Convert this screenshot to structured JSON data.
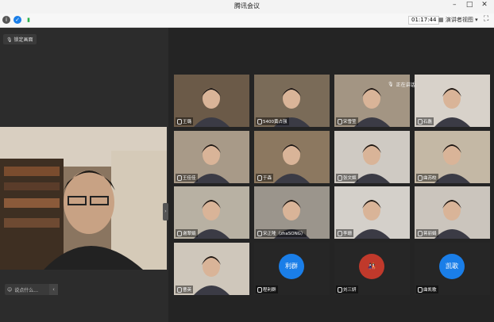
{
  "window": {
    "title": "腾讯会议",
    "minimize": "–",
    "maximize": "□",
    "close": "✕"
  },
  "toolbar": {
    "timer": "01:17:44",
    "speaker_view": "演讲者视图",
    "dropdown": "▾",
    "fullscreen": "⛶"
  },
  "left": {
    "mute_tag": "锁定画面",
    "chat_placeholder": "说点什么...",
    "chat_arrow": "‹",
    "collapse_arrow": "›"
  },
  "speaking_label": "正在讲话:",
  "participants": [
    {
      "name": "王璐",
      "bg": "#6b5a48"
    },
    {
      "name": "5400黄占强",
      "bg": "#7a6b58"
    },
    {
      "name": "宋雪莹",
      "bg": "#a39583"
    },
    {
      "name": "石磊",
      "bg": "#d8d2ca"
    },
    {
      "name": "王佳佳",
      "bg": "#a89a88"
    },
    {
      "name": "于森",
      "bg": "#8c7860"
    },
    {
      "name": "张文姬",
      "bg": "#cfcac3"
    },
    {
      "name": "曲苏皎",
      "bg": "#c4b8a5"
    },
    {
      "name": "谢翠娟",
      "bg": "#b8b1a3"
    },
    {
      "name": "宋正隆（zhaSONG）",
      "bg": "#9b958c"
    },
    {
      "name": "李珊",
      "bg": "#d4d0ca"
    },
    {
      "name": "蒋丽娟",
      "bg": "#cbc5bd"
    },
    {
      "name": "曹英",
      "bg": "#cfc7bb"
    },
    {
      "name": "程利群",
      "bg": "#262626",
      "avatar": "利群"
    },
    {
      "name": "刘三妍",
      "bg": "#262626",
      "avatar": "🎎"
    },
    {
      "name": "曲凯歌",
      "bg": "#262626",
      "avatar": "凯歌"
    }
  ]
}
